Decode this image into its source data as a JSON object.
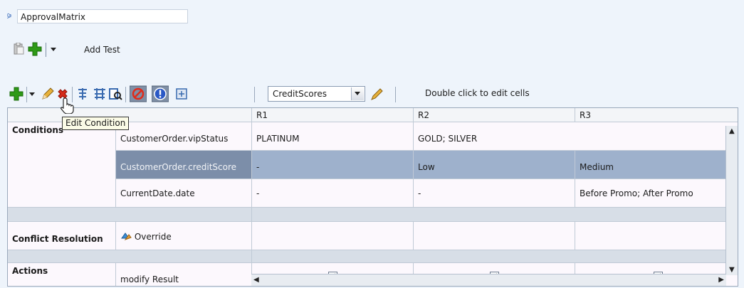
{
  "header": {
    "dictionary_name": "ApprovalMatrix",
    "add_test_label": "Add Test"
  },
  "toolbar": {
    "bucketset_value": "CreditScores",
    "hint": "Double click to edit cells",
    "tooltip": "Edit Condition"
  },
  "grid": {
    "columns": [
      "R1",
      "R2",
      "R3"
    ],
    "conditions_label": "Conditions",
    "conditions": [
      {
        "name": "CustomerOrder.vipStatus",
        "r1": "PLATINUM",
        "r2": "GOLD; SILVER",
        "r3": ""
      },
      {
        "name": "CustomerOrder.creditScore",
        "r1": "-",
        "r2": "Low",
        "r3": "Medium"
      },
      {
        "name": "CurrentDate.date",
        "r1": "-",
        "r2": "-",
        "r3": "Before Promo; After Promo"
      }
    ],
    "conflict_label": "Conflict Resolution",
    "conflict_value": "Override",
    "actions_label": "Actions",
    "action_name": "modify Result"
  },
  "colors": {
    "selected_row": "#9eb1cc",
    "selected_head": "#7c8ea9",
    "add_green": "#2e9a16",
    "delete_red": "#d62b1a"
  }
}
